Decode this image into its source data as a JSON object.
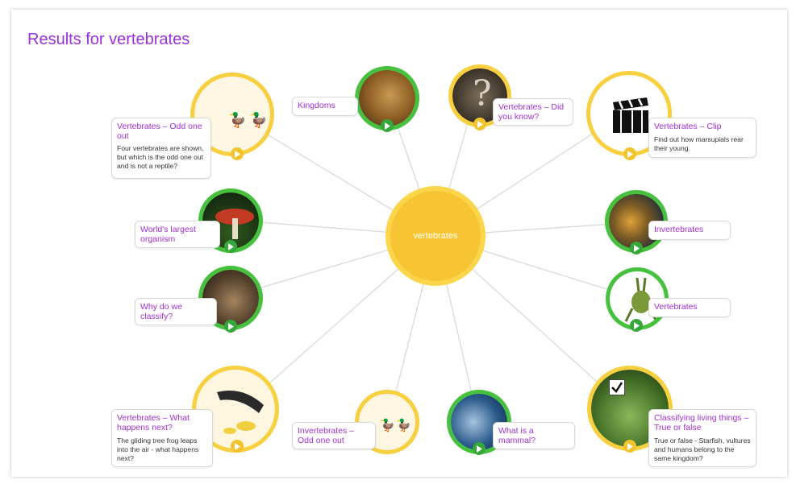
{
  "page": {
    "title": "Results for vertebrates"
  },
  "hub": {
    "label": "vertebrates"
  },
  "results": [
    {
      "title": "Vertebrates – Odd one out",
      "desc": "Four vertebrates are shown, but which is the odd one out and is not a reptile?"
    },
    {
      "title": "Kingdoms",
      "desc": ""
    },
    {
      "title": "Vertebrates – Did you know?",
      "desc": ""
    },
    {
      "title": "Vertebrates – Clip",
      "desc": "Find out how marsupials rear their young."
    },
    {
      "title": "World's largest organism",
      "desc": ""
    },
    {
      "title": "Invertebrates",
      "desc": ""
    },
    {
      "title": "Why do we classify?",
      "desc": ""
    },
    {
      "title": "Vertebrates",
      "desc": ""
    },
    {
      "title": "Vertebrates – What happens next?",
      "desc": "The gliding tree frog leaps into the air - what happens next?"
    },
    {
      "title": "Invertebrates – Odd one out",
      "desc": ""
    },
    {
      "title": "What is a mammal?",
      "desc": ""
    },
    {
      "title": "Classifying living things – True or false",
      "desc": "True or false - Starfish, vultures and humans belong to the same kingdom?"
    }
  ],
  "icons": {
    "play": "play-icon",
    "ducks": "duck-icon",
    "question": "question-mark-icon",
    "clapper": "clapperboard-icon",
    "check": "checkmark-icon"
  },
  "colors": {
    "title": "#9b2fe0",
    "card_title": "#a22fd6",
    "yellow": "#f7cf3f",
    "green": "#45c13e",
    "hub": "#f7c533"
  }
}
